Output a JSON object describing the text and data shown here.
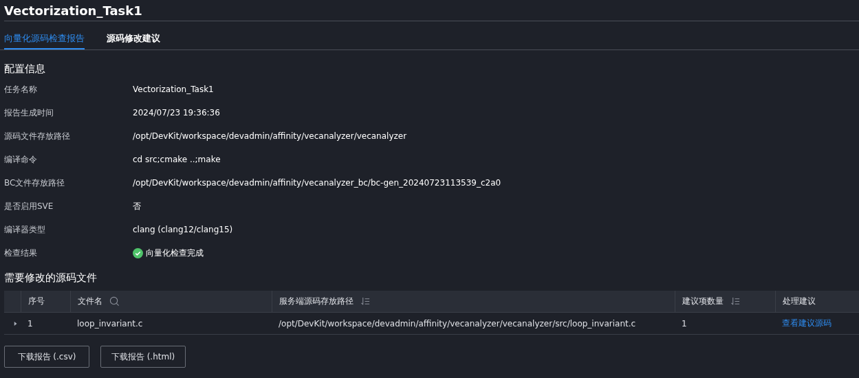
{
  "title": "Vectorization_Task1",
  "tabs": [
    {
      "label": "向量化源码检查报告",
      "selected": true
    },
    {
      "label": "源码修改建议",
      "selected": false
    }
  ],
  "config": {
    "heading": "配置信息",
    "rows": [
      {
        "label": "任务名称",
        "value": "Vectorization_Task1"
      },
      {
        "label": "报告生成时间",
        "value": "2024/07/23 19:36:36"
      },
      {
        "label": "源码文件存放路径",
        "value": "/opt/DevKit/workspace/devadmin/affinity/vecanalyzer/vecanalyzer"
      },
      {
        "label": "编译命令",
        "value": "cd src;cmake ..;make"
      },
      {
        "label": "BC文件存放路径",
        "value": "/opt/DevKit/workspace/devadmin/affinity/vecanalyzer_bc/bc-gen_20240723113539_c2a0"
      },
      {
        "label": "是否启用SVE",
        "value": "否"
      },
      {
        "label": "编译器类型",
        "value": "clang (clang12/clang15)"
      },
      {
        "label": "检查结果",
        "value": "向量化检查完成",
        "kind": "status"
      }
    ]
  },
  "files": {
    "heading": "需要修改的源码文件",
    "columns": [
      {
        "label": "序号",
        "kind": "plain"
      },
      {
        "label": "文件名",
        "kind": "searchable"
      },
      {
        "label": "服务端源码存放路径",
        "kind": "sortable"
      },
      {
        "label": "建议项数量",
        "kind": "sortable"
      },
      {
        "label": "处理建议",
        "kind": "plain"
      }
    ],
    "rows": [
      {
        "expanded": false,
        "index": "1",
        "file": "loop_invariant.c",
        "path": "/opt/DevKit/workspace/devadmin/affinity/vecanalyzer/vecanalyzer/src/loop_invariant.c",
        "count": "1",
        "action": "查看建议源码"
      }
    ]
  },
  "buttons": [
    "下载报告 (.csv)",
    "下载报告 (.html)"
  ]
}
